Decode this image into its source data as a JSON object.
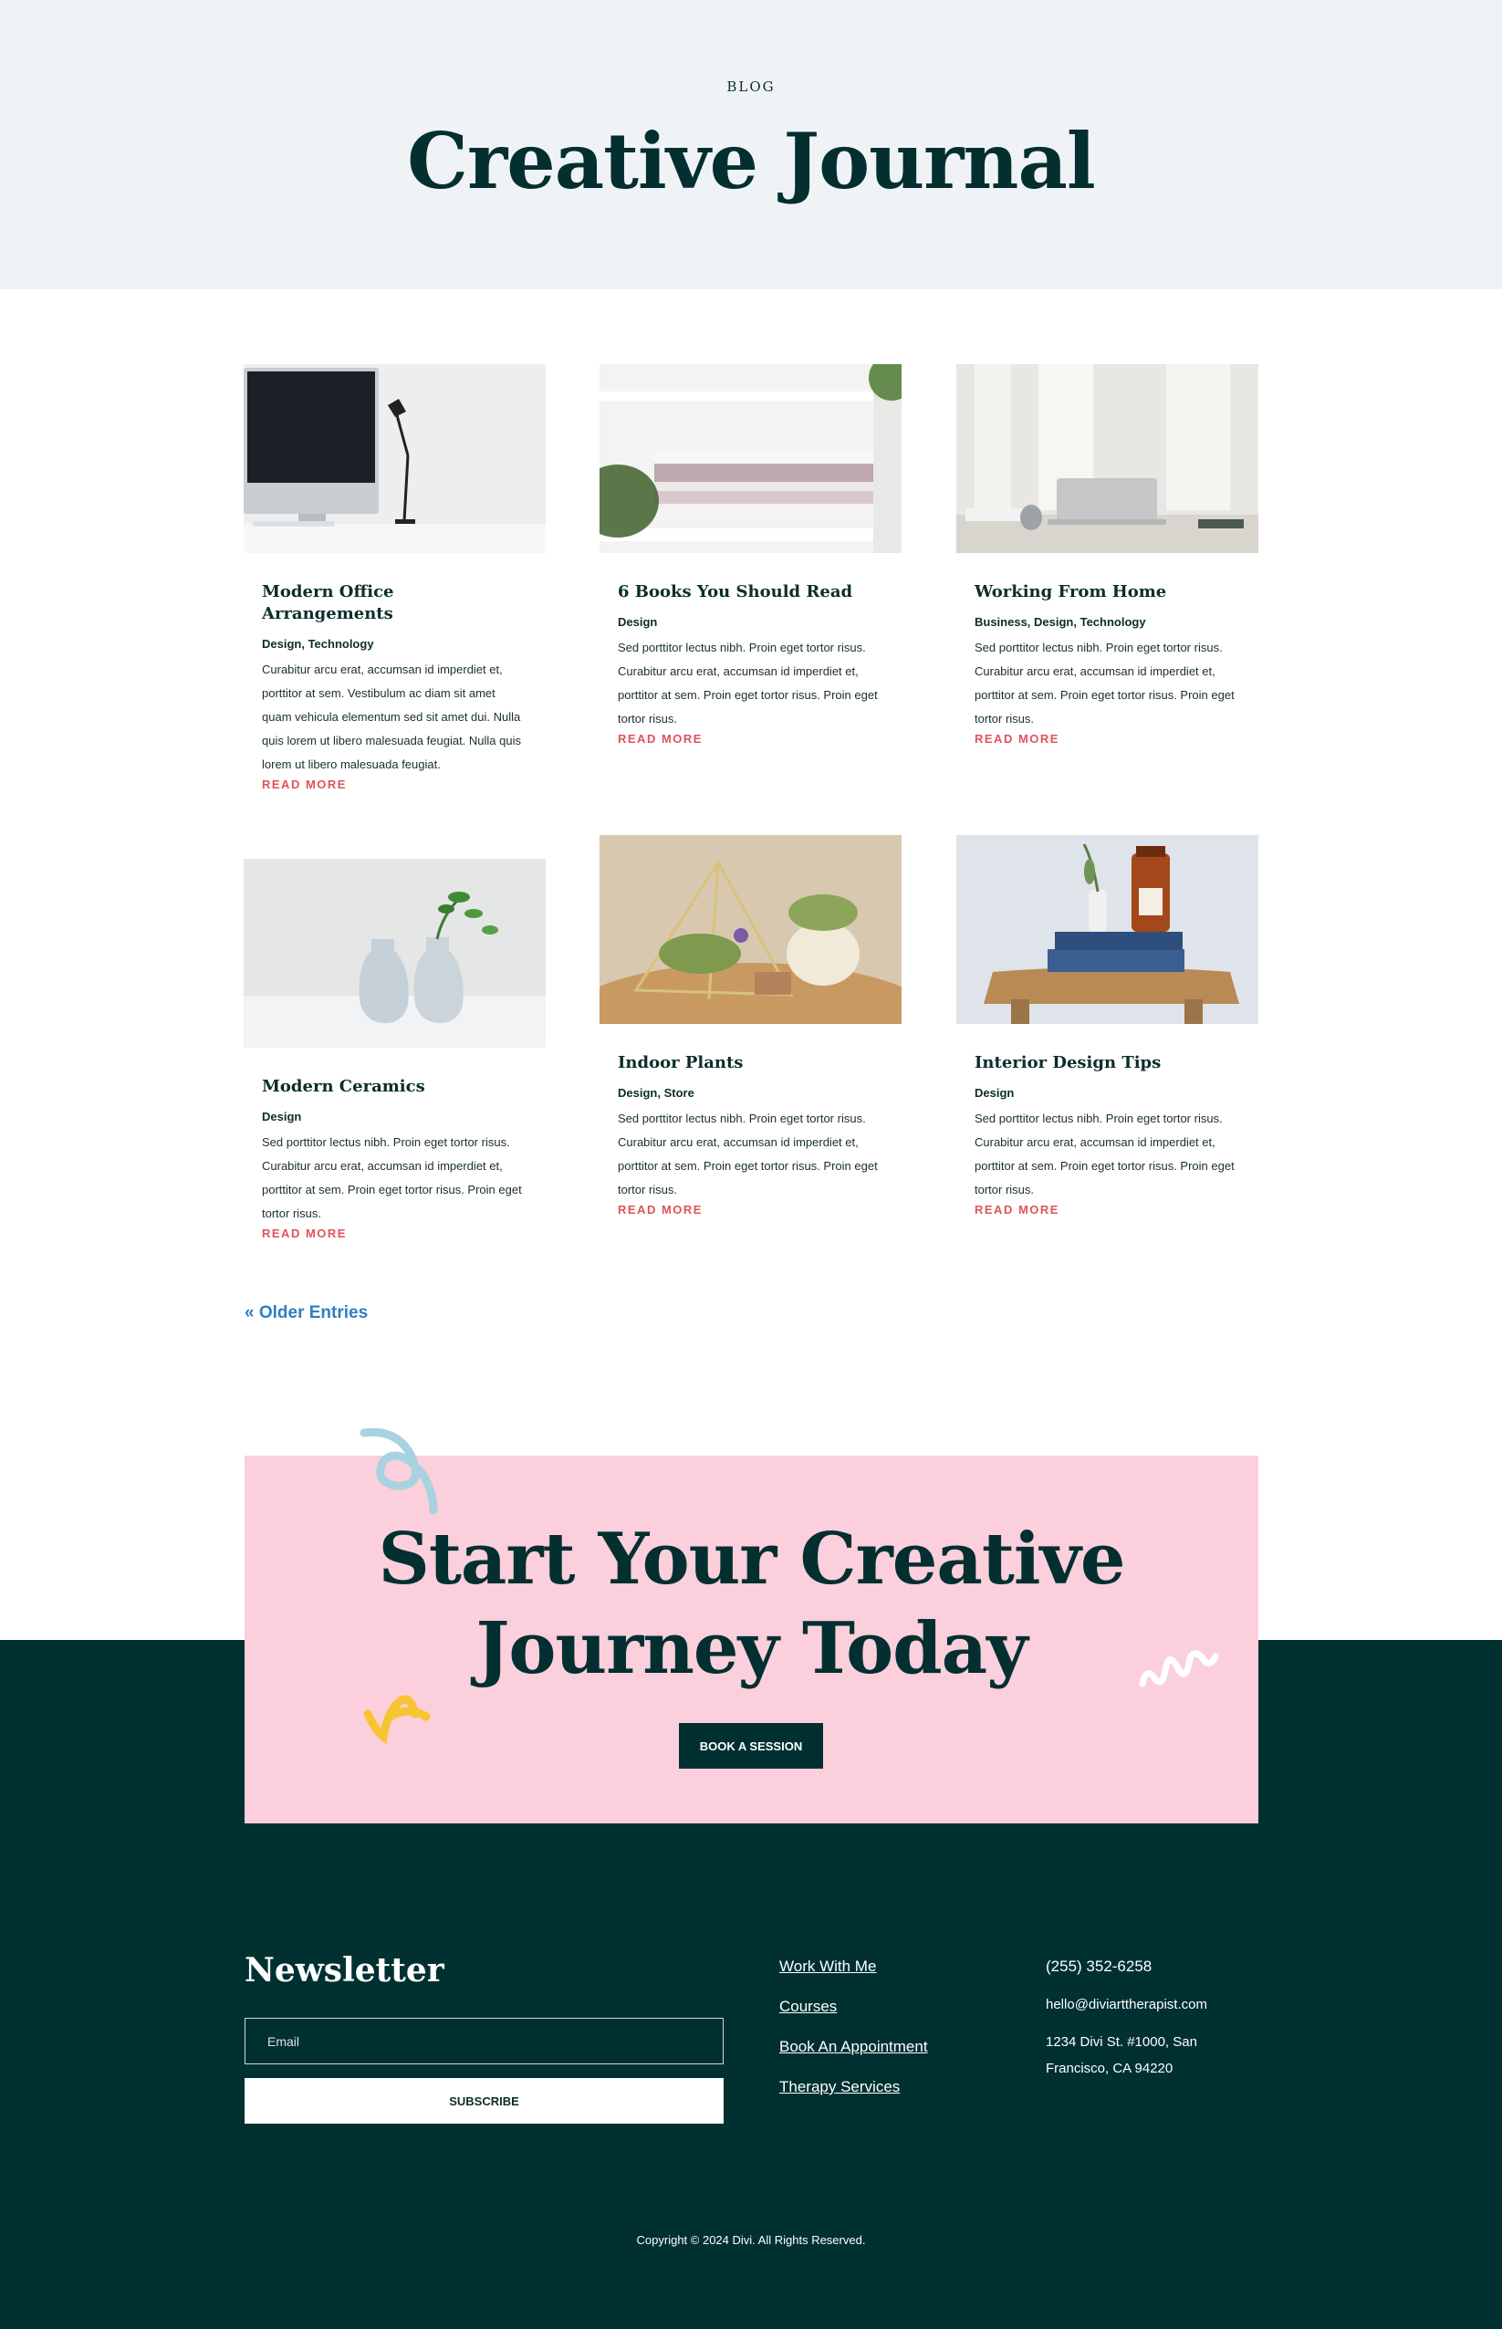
{
  "hero": {
    "eyebrow": "BLOG",
    "title": "Creative Journal"
  },
  "posts": [
    {
      "title": "Modern Office Arrangements",
      "categories": "Design, Technology",
      "excerpt": "Curabitur arcu erat, accumsan id imperdiet et, porttitor at sem. Vestibulum ac diam sit amet quam vehicula elementum sed sit amet dui. Nulla quis lorem ut libero malesuada feugiat. Nulla quis lorem ut libero malesuada feugiat.",
      "read_more": "READ MORE",
      "image": "office-desk-monitor-lamp"
    },
    {
      "title": "6 Books You Should Read",
      "categories": "Design",
      "excerpt": "Sed porttitor lectus nibh. Proin eget tortor risus. Curabitur arcu erat, accumsan id imperdiet et, porttitor at sem. Proin eget tortor risus. Proin eget tortor risus.",
      "read_more": "READ MORE",
      "image": "books-on-white-shelf"
    },
    {
      "title": "Working From Home",
      "categories": "Business, Design, Technology",
      "excerpt": "Sed porttitor lectus nibh. Proin eget tortor risus. Curabitur arcu erat, accumsan id imperdiet et, porttitor at sem. Proin eget tortor risus. Proin eget tortor risus.",
      "read_more": "READ MORE",
      "image": "laptop-on-desk-curtains"
    },
    {
      "title": "Modern Ceramics",
      "categories": "Design",
      "excerpt": "Sed porttitor lectus nibh. Proin eget tortor risus. Curabitur arcu erat, accumsan id imperdiet et, porttitor at sem. Proin eget tortor risus. Proin eget tortor risus.",
      "read_more": "READ MORE",
      "image": "white-ceramic-vases"
    },
    {
      "title": "Indoor Plants",
      "categories": "Design, Store",
      "excerpt": "Sed porttitor lectus nibh. Proin eget tortor risus. Curabitur arcu erat, accumsan id imperdiet et, porttitor at sem. Proin eget tortor risus. Proin eget tortor risus.",
      "read_more": "READ MORE",
      "image": "air-plants-terrarium"
    },
    {
      "title": "Interior Design Tips",
      "categories": "Design",
      "excerpt": "Sed porttitor lectus nibh. Proin eget tortor risus. Curabitur arcu erat, accumsan id imperdiet et, porttitor at sem. Proin eget tortor risus. Proin eget tortor risus.",
      "read_more": "READ MORE",
      "image": "books-jar-on-stool"
    }
  ],
  "pagination": {
    "older_entries": "« Older Entries"
  },
  "cta": {
    "title_line1": "Start Your Creative",
    "title_line2": "Journey Today",
    "button": "BOOK A SESSION"
  },
  "footer": {
    "newsletter_title": "Newsletter",
    "email_placeholder": "Email",
    "subscribe": "SUBSCRIBE",
    "links": [
      "Work With Me",
      "Courses",
      "Book An Appointment",
      "Therapy Services"
    ],
    "phone": "(255) 352-6258",
    "email": "hello@diviarttherapist.com",
    "address": "1234 Divi St. #1000, San Francisco, CA 94220",
    "copyright": "Copyright © 2024 Divi. All Rights Reserved."
  },
  "colors": {
    "hero_bg": "#f0f3f6",
    "dark_green": "#013031",
    "cta_pink": "#fccfdc",
    "read_more": "#e0535b",
    "link_blue": "#2e7fc2",
    "squiggle_blue": "#a9d2e0",
    "squiggle_yellow": "#f7c531"
  }
}
